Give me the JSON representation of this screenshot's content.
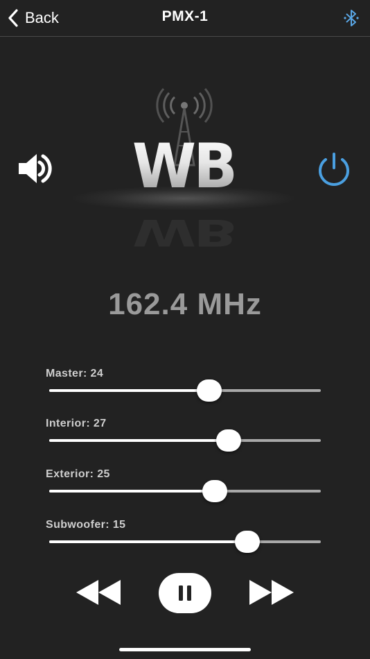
{
  "navbar": {
    "back_label": "Back",
    "title": "PMX-1",
    "bluetooth_icon": "bluetooth-icon",
    "bluetooth_color": "#5aa7e6"
  },
  "controls": {
    "volume_icon": "speaker-volume-icon",
    "power_icon": "power-icon",
    "power_color": "#4a9fe0"
  },
  "logo": {
    "text": "WB",
    "icon": "radio-tower-icon"
  },
  "frequency": "162.4 MHz",
  "sliders": [
    {
      "label": "Master: 24",
      "fraction": 0.59
    },
    {
      "label": "Interior: 27",
      "fraction": 0.66
    },
    {
      "label": "Exterior: 25",
      "fraction": 0.61
    },
    {
      "label": "Subwoofer: 15",
      "fraction": 0.73
    }
  ],
  "transport": {
    "rewind_icon": "rewind-icon",
    "pause_icon": "pause-icon",
    "forward_icon": "fast-forward-icon"
  },
  "colors": {
    "background": "#222222",
    "track": "#a8a8a8",
    "frequency_text": "#9a9a9a"
  }
}
